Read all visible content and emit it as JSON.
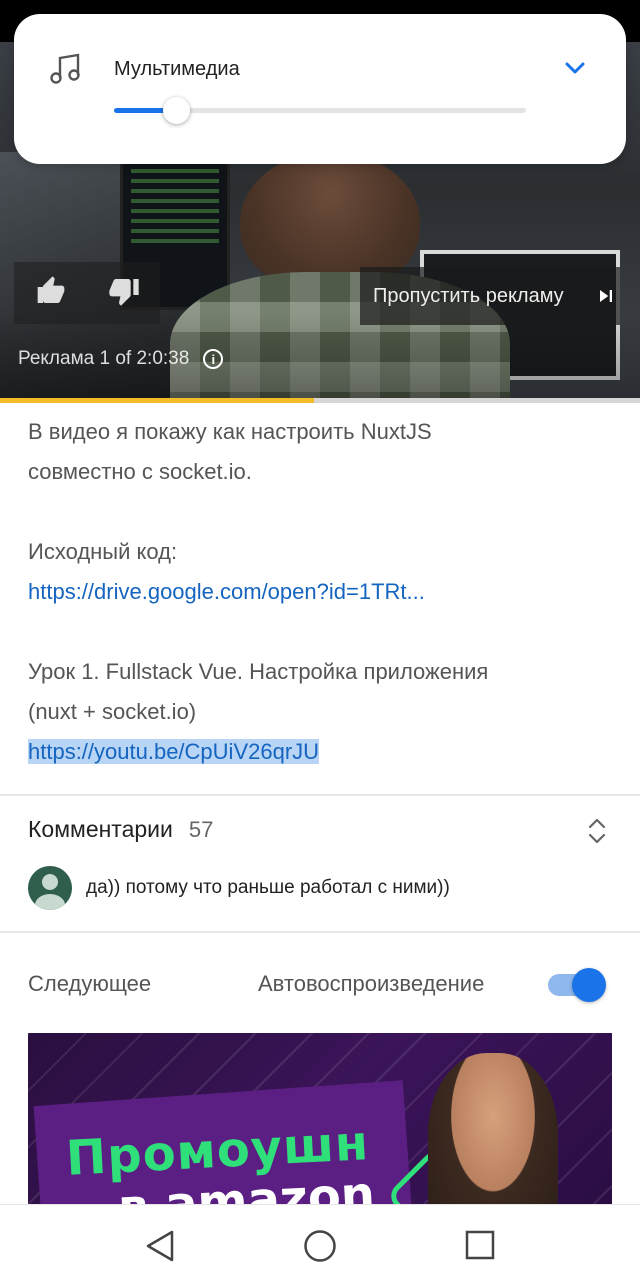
{
  "volume": {
    "title": "Мультимедиа",
    "level_percent": 15,
    "icon": "music-note-icon",
    "expand_icon": "chevron-down-icon",
    "accent_color": "#1a73e8"
  },
  "player": {
    "skip_ad_label": "Пропустить рекламу",
    "ad_label": "Реклама 1 of 2",
    "ad_time": "0:38",
    "ad_progress_percent": 49,
    "progress_color": "#f2bd27",
    "icons": [
      "thumbs-up-icon",
      "thumbs-down-icon",
      "skip-next-icon",
      "info-icon"
    ]
  },
  "description": {
    "line1": "В видео я покажу как настроить NuxtJS",
    "line2": "совместно с socket.io.",
    "source_label": "Исходный код:",
    "source_link": "https://drive.google.com/open?id=1TRt...",
    "lesson_line1": "Урок 1. Fullstack Vue. Настройка приложения",
    "lesson_line2": "(nuxt + socket.io)",
    "lesson_link": "https://youtu.be/CpUiV26qrJU"
  },
  "comments": {
    "title": "Комментарии",
    "count": "57",
    "top_comment": "да)) потому что раньше работал с ними))"
  },
  "next": {
    "label": "Следующее",
    "autoplay_label": "Автовоспроизведение",
    "autoplay_on": true,
    "thumbnail": {
      "title_line1": "Промоушн",
      "title_line2": "в amazon"
    }
  },
  "nav": {
    "icons": [
      "back-icon",
      "home-icon",
      "recent-apps-icon"
    ]
  }
}
